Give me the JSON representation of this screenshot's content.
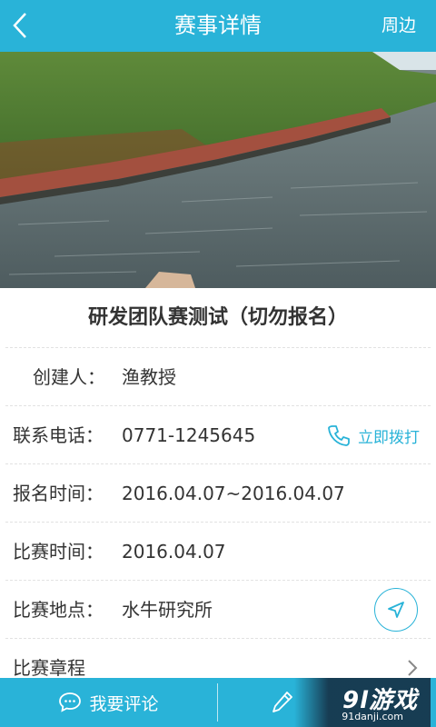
{
  "header": {
    "title": "赛事详情",
    "right_action": "周边"
  },
  "event": {
    "title": "研发团队赛测试（切勿报名）"
  },
  "details": {
    "creator": {
      "label": "创建人：",
      "value": "渔教授"
    },
    "phone": {
      "label": "联系电话：",
      "value": "0771-1245645",
      "action": "立即拨打"
    },
    "signup_time": {
      "label": "报名时间：",
      "value": "2016.04.07~2016.04.07"
    },
    "match_time": {
      "label": "比赛时间：",
      "value": "2016.04.07"
    },
    "location": {
      "label": "比赛地点：",
      "value": "水牛研究所"
    },
    "schedule": {
      "label": "比赛章程"
    }
  },
  "bottom": {
    "comment_label": "我要评论"
  },
  "watermark": {
    "logo": "9l游戏",
    "url": "91danji.com"
  },
  "colors": {
    "accent": "#29b3d8"
  }
}
